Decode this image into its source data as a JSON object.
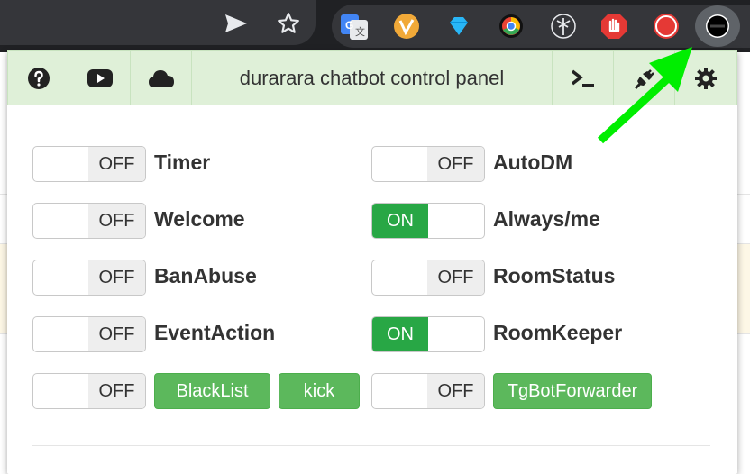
{
  "popup": {
    "title": "durarara chatbot control panel",
    "nav_icons": [
      "help-icon",
      "youtube-icon",
      "cloud-icon",
      "terminal-icon",
      "plug-icon",
      "gear-icon"
    ]
  },
  "toggles": [
    {
      "name": "Timer",
      "state": "OFF"
    },
    {
      "name": "AutoDM",
      "state": "OFF"
    },
    {
      "name": "Welcome",
      "state": "OFF"
    },
    {
      "name": "Always/me",
      "state": "ON"
    },
    {
      "name": "BanAbuse",
      "state": "OFF"
    },
    {
      "name": "RoomStatus",
      "state": "OFF"
    },
    {
      "name": "EventAction",
      "state": "OFF"
    },
    {
      "name": "RoomKeeper",
      "state": "ON"
    },
    {
      "name": "BlackList",
      "state": "OFF"
    },
    {
      "name": "TgBotForwarder",
      "state": "OFF"
    }
  ],
  "buttons": {
    "blacklist": "BlackList",
    "kick": "kick",
    "tgbot": "TgBotForwarder"
  },
  "labels": {
    "timer": "Timer",
    "autodm": "AutoDM",
    "welcome": "Welcome",
    "alwaysme": "Always/me",
    "banabuse": "BanAbuse",
    "roomstatus": "RoomStatus",
    "eventaction": "EventAction",
    "roomkeeper": "RoomKeeper"
  },
  "states": {
    "off": "OFF",
    "on": "ON"
  },
  "annotation": {
    "arrow_color": "#00ee00"
  }
}
